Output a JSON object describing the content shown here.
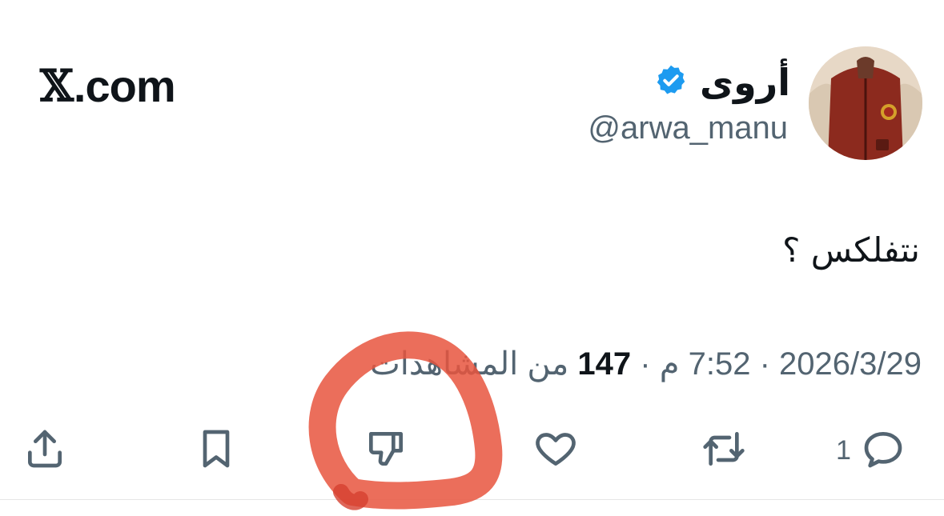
{
  "brand": {
    "x_mark": "𝕏",
    "domain": ".com"
  },
  "author": {
    "display_name": "أروى",
    "handle": "@arwa_manu",
    "verified": true,
    "verified_color": "#1d9bf0"
  },
  "tweet": {
    "text": "نتفلكس ؟"
  },
  "meta": {
    "date": "2026/3/29",
    "separator": "·",
    "time": "7:52 م",
    "views_count": "147",
    "views_label": "من المشاهدات"
  },
  "actions": {
    "reply_count": "1",
    "icon_color": "#536471"
  },
  "annotation": {
    "color": "#e8553e"
  }
}
